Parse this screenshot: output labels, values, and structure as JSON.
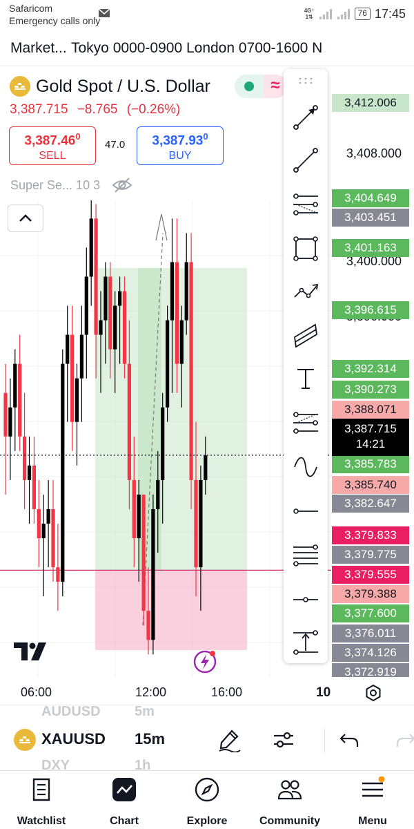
{
  "status_bar": {
    "carrier": "Safaricom",
    "emergency": "Emergency calls only",
    "network_top": "4G⁺",
    "network_bottom": "1⇅",
    "battery": "76",
    "time": "17:45"
  },
  "session_bar": {
    "title": "Market...",
    "hours": "Tokyo 0000-0900 London 0700-1600 N"
  },
  "header": {
    "symbol_name": "Gold Spot / U.S. Dollar",
    "status_wave_glyph": "≈",
    "last_price": "3,387.715",
    "change": "−8.765",
    "change_pct": "(−0.26%)",
    "sell_price": "3,387.46",
    "sell_price_sup": "0",
    "sell_label": "SELL",
    "spread": "47.0",
    "buy_price": "3,387.93",
    "buy_price_sup": "0",
    "buy_label": "BUY",
    "indicator_label": "Super Se... 10 3"
  },
  "price_scale": {
    "ticks": [
      "3,408.000",
      "3,400.000",
      "3,396.000"
    ],
    "labels": [
      {
        "text": "3,412.006",
        "style": "pl-lightgreen"
      },
      {
        "text": "3,404.649",
        "style": "pl-green"
      },
      {
        "text": "3,403.451",
        "style": "pl-gray"
      },
      {
        "text": "3,401.163",
        "style": "pl-green"
      },
      {
        "text": "3,396.615",
        "style": "pl-green"
      },
      {
        "text": "3,392.314",
        "style": "pl-green"
      },
      {
        "text": "3,390.273",
        "style": "pl-green"
      },
      {
        "text": "3,388.071",
        "style": "pl-pink"
      },
      {
        "text": "3,385.783",
        "style": "pl-green"
      },
      {
        "text": "3,385.740",
        "style": "pl-pink"
      },
      {
        "text": "3,382.647",
        "style": "pl-gray"
      },
      {
        "text": "3,379.833",
        "style": "pl-magenta"
      },
      {
        "text": "3,379.775",
        "style": "pl-gray"
      },
      {
        "text": "3,379.555",
        "style": "pl-magenta"
      },
      {
        "text": "3,379.388",
        "style": "pl-pink"
      },
      {
        "text": "3,377.600",
        "style": "pl-green"
      },
      {
        "text": "3,376.011",
        "style": "pl-gray"
      },
      {
        "text": "3,374.126",
        "style": "pl-gray"
      },
      {
        "text": "3,372.919",
        "style": "pl-gray"
      }
    ],
    "current_price": "3,387.715",
    "current_timer": "14:21"
  },
  "chart_data": {
    "type": "candlestick",
    "timeframe": "15m",
    "x_tick_labels": [
      "06:00",
      "12:00",
      "16:00"
    ],
    "candles": [
      {
        "o": 3392,
        "h": 3394,
        "l": 3385,
        "c": 3389
      },
      {
        "o": 3389,
        "h": 3393,
        "l": 3386,
        "c": 3391
      },
      {
        "o": 3391,
        "h": 3395,
        "l": 3388,
        "c": 3394
      },
      {
        "o": 3394,
        "h": 3396,
        "l": 3388,
        "c": 3389
      },
      {
        "o": 3389,
        "h": 3392,
        "l": 3384,
        "c": 3386
      },
      {
        "o": 3386,
        "h": 3389,
        "l": 3383,
        "c": 3387
      },
      {
        "o": 3387,
        "h": 3389,
        "l": 3383,
        "c": 3384
      },
      {
        "o": 3384,
        "h": 3386,
        "l": 3380,
        "c": 3382
      },
      {
        "o": 3382,
        "h": 3385,
        "l": 3378,
        "c": 3383
      },
      {
        "o": 3383,
        "h": 3386,
        "l": 3380,
        "c": 3384
      },
      {
        "o": 3384,
        "h": 3386,
        "l": 3379,
        "c": 3380
      },
      {
        "o": 3380,
        "h": 3383,
        "l": 3377,
        "c": 3379
      },
      {
        "o": 3379,
        "h": 3395,
        "l": 3378,
        "c": 3394
      },
      {
        "o": 3394,
        "h": 3398,
        "l": 3390,
        "c": 3396
      },
      {
        "o": 3396,
        "h": 3398,
        "l": 3388,
        "c": 3390
      },
      {
        "o": 3390,
        "h": 3394,
        "l": 3387,
        "c": 3393
      },
      {
        "o": 3393,
        "h": 3398,
        "l": 3390,
        "c": 3396
      },
      {
        "o": 3396,
        "h": 3402,
        "l": 3393,
        "c": 3400
      },
      {
        "o": 3400,
        "h": 3406,
        "l": 3398,
        "c": 3404
      },
      {
        "o": 3404,
        "h": 3405,
        "l": 3393,
        "c": 3396
      },
      {
        "o": 3396,
        "h": 3399,
        "l": 3392,
        "c": 3397
      },
      {
        "o": 3397,
        "h": 3401,
        "l": 3394,
        "c": 3400
      },
      {
        "o": 3400,
        "h": 3401,
        "l": 3393,
        "c": 3395
      },
      {
        "o": 3395,
        "h": 3399,
        "l": 3392,
        "c": 3398
      },
      {
        "o": 3398,
        "h": 3400,
        "l": 3394,
        "c": 3399
      },
      {
        "o": 3399,
        "h": 3400,
        "l": 3393,
        "c": 3394
      },
      {
        "o": 3394,
        "h": 3397,
        "l": 3384,
        "c": 3386
      },
      {
        "o": 3386,
        "h": 3389,
        "l": 3380,
        "c": 3382
      },
      {
        "o": 3382,
        "h": 3386,
        "l": 3379,
        "c": 3385
      },
      {
        "o": 3385,
        "h": 3385,
        "l": 3376,
        "c": 3377
      },
      {
        "o": 3377,
        "h": 3380,
        "l": 3374,
        "c": 3375
      },
      {
        "o": 3375,
        "h": 3385,
        "l": 3374,
        "c": 3384
      },
      {
        "o": 3384,
        "h": 3388,
        "l": 3381,
        "c": 3386
      },
      {
        "o": 3386,
        "h": 3392,
        "l": 3383,
        "c": 3391
      },
      {
        "o": 3391,
        "h": 3398,
        "l": 3390,
        "c": 3397
      },
      {
        "o": 3397,
        "h": 3404,
        "l": 3392,
        "c": 3401
      },
      {
        "o": 3401,
        "h": 3404,
        "l": 3392,
        "c": 3394
      },
      {
        "o": 3394,
        "h": 3398,
        "l": 3391,
        "c": 3397
      },
      {
        "o": 3397,
        "h": 3403,
        "l": 3396,
        "c": 3401
      },
      {
        "o": 3401,
        "h": 3403,
        "l": 3384,
        "c": 3386
      },
      {
        "o": 3386,
        "h": 3390,
        "l": 3378,
        "c": 3380
      },
      {
        "o": 3380,
        "h": 3387,
        "l": 3377,
        "c": 3386
      },
      {
        "o": 3386,
        "h": 3389,
        "l": 3385,
        "c": 3387.7
      }
    ],
    "price_range": [
      3370,
      3413
    ],
    "position_box": {
      "entry": 3379.8,
      "target": 3400.6,
      "stop": 3374.3,
      "start_index": 13,
      "end_index": 35
    },
    "lines": {
      "current": 3387.715,
      "entry_line": 3379.8
    }
  },
  "toolbar": {
    "symbol": "XAUUSD",
    "timeframe": "15m",
    "ghost_symbol_above": "AUDUSD",
    "ghost_tf_above": "5m",
    "ghost_symbol_below": "DXY",
    "ghost_tf_below": "1h",
    "interval_label": "10"
  },
  "nav": {
    "items": [
      {
        "label": "Watchlist"
      },
      {
        "label": "Chart"
      },
      {
        "label": "Explore"
      },
      {
        "label": "Community"
      },
      {
        "label": "Menu"
      }
    ]
  },
  "colors": {
    "up": "#000000",
    "down": "#f23645",
    "accent_blue": "#2962ff",
    "profit_zone": "#c8e6c9",
    "loss_zone": "#f8bbd0"
  }
}
